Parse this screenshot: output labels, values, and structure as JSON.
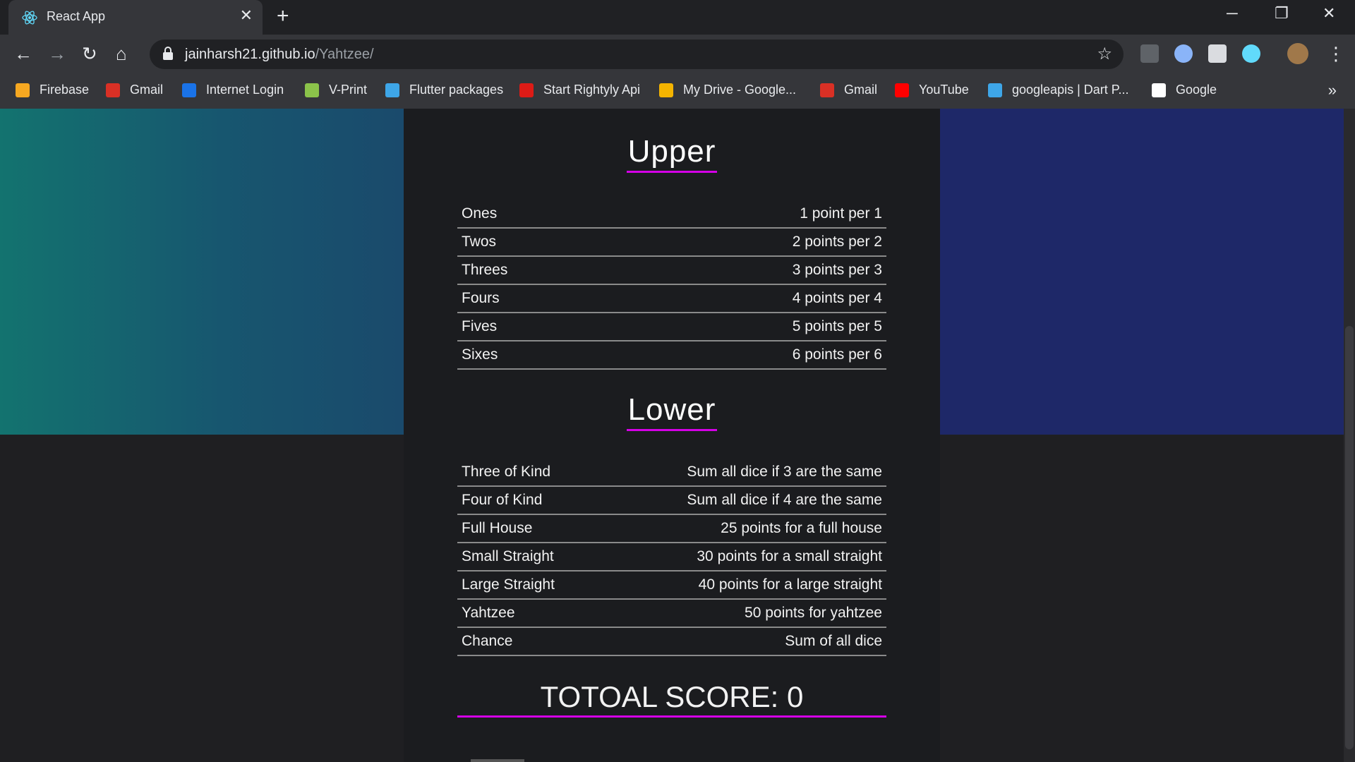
{
  "browser": {
    "tab_title": "React App",
    "url_host": "jainharsh21.github.io",
    "url_path": "/Yahtzee/",
    "bookmarks": [
      {
        "label": "Firebase",
        "icon": "firebase-icon",
        "color": "#f6a821"
      },
      {
        "label": "Gmail",
        "icon": "gmail-icon",
        "color": "#d93025"
      },
      {
        "label": "Internet Login",
        "icon": "s-logo-icon",
        "color": "#1a73e8"
      },
      {
        "label": "V-Print",
        "icon": "vprint-icon",
        "color": "#8bc34a"
      },
      {
        "label": "Flutter packages",
        "icon": "dart-icon",
        "color": "#3ea6e8"
      },
      {
        "label": "Start Rightyly Api",
        "icon": "angular-icon",
        "color": "#dd1b16"
      },
      {
        "label": "My Drive - Google...",
        "icon": "drive-icon",
        "color": "#f4b400"
      },
      {
        "label": "Gmail",
        "icon": "gmail-icon",
        "color": "#d93025"
      },
      {
        "label": "YouTube",
        "icon": "youtube-icon",
        "color": "#ff0000"
      },
      {
        "label": "googleapis | Dart P...",
        "icon": "dart-icon",
        "color": "#3ea6e8"
      },
      {
        "label": "Google",
        "icon": "google-icon",
        "color": "#ffffff"
      }
    ]
  },
  "scorecard": {
    "upper_title": "Upper",
    "upper_rules": [
      {
        "name": "Ones",
        "desc": "1 point per 1"
      },
      {
        "name": "Twos",
        "desc": "2 points per 2"
      },
      {
        "name": "Threes",
        "desc": "3 points per 3"
      },
      {
        "name": "Fours",
        "desc": "4 points per 4"
      },
      {
        "name": "Fives",
        "desc": "5 points per 5"
      },
      {
        "name": "Sixes",
        "desc": "6 points per 6"
      }
    ],
    "lower_title": "Lower",
    "lower_rules": [
      {
        "name": "Three of Kind",
        "desc": "Sum all dice if 3 are the same"
      },
      {
        "name": "Four of Kind",
        "desc": "Sum all dice if 4 are the same"
      },
      {
        "name": "Full House",
        "desc": "25 points for a full house"
      },
      {
        "name": "Small Straight",
        "desc": "30 points for a small straight"
      },
      {
        "name": "Large Straight",
        "desc": "40 points for a large straight"
      },
      {
        "name": "Yahtzee",
        "desc": "50 points for yahtzee"
      },
      {
        "name": "Chance",
        "desc": "Sum of all dice"
      }
    ],
    "total_label": "TOTOAL SCORE: 0"
  },
  "colors": {
    "accent": "#d400e6",
    "left_gradient_start": "#13736f",
    "right_panel": "#1e2868"
  }
}
